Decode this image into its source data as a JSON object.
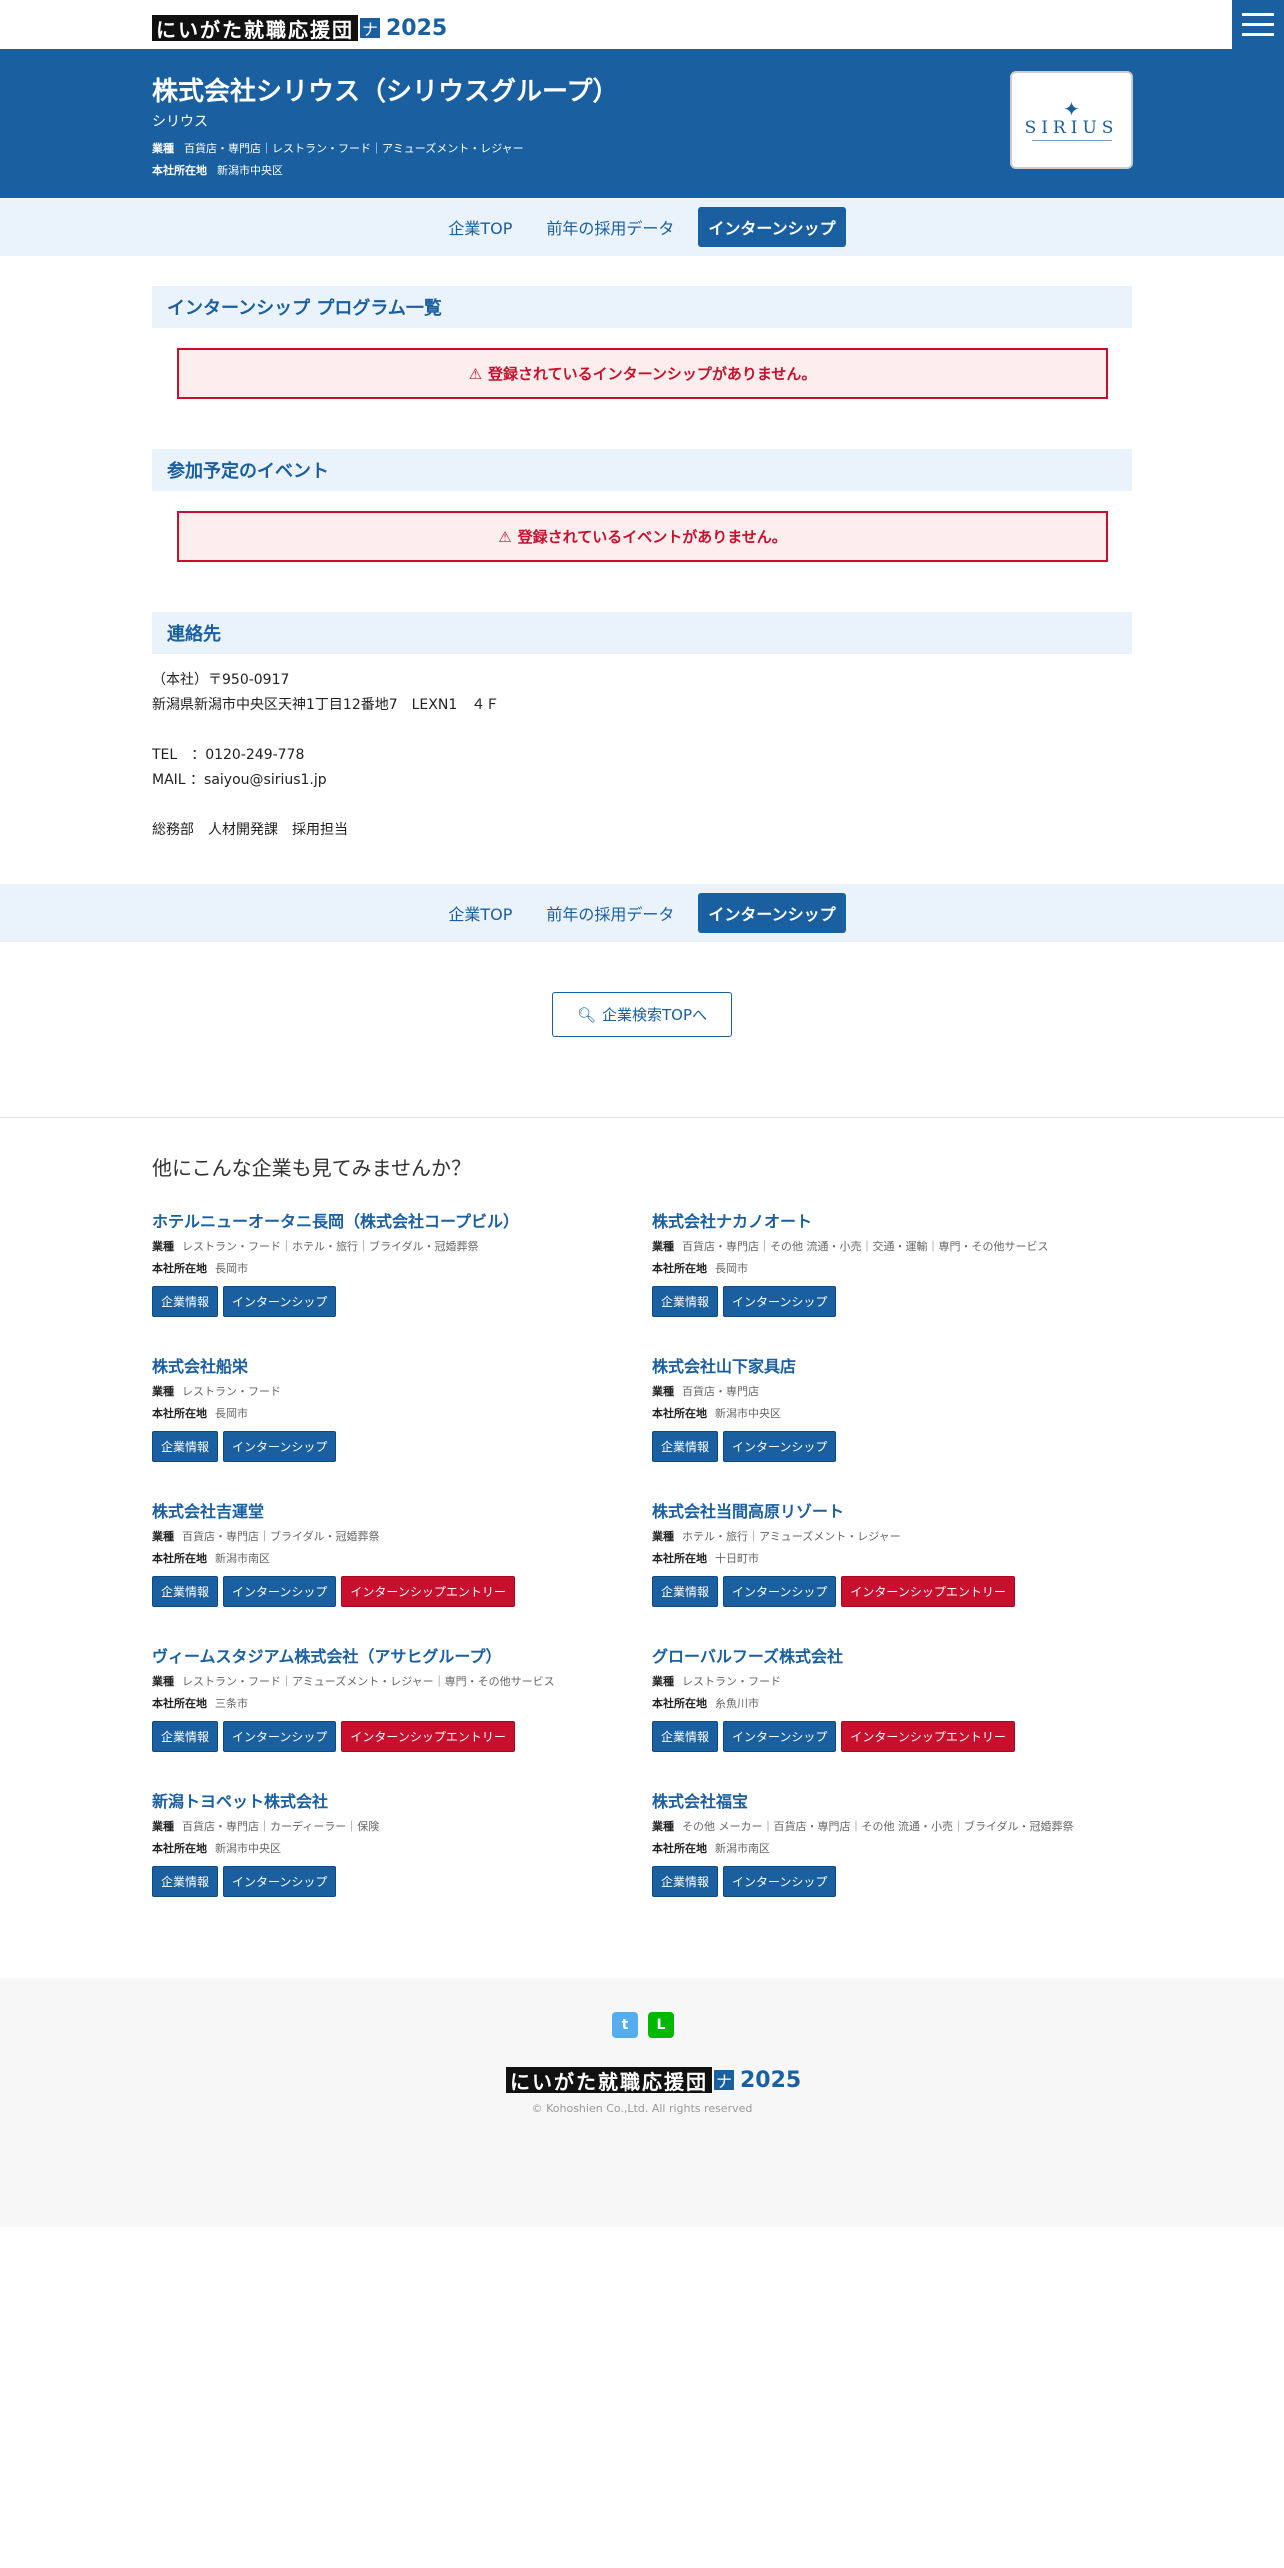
{
  "brand": {
    "logo_text": "にいがた就職応援団",
    "logo_mark": "ナビ",
    "year": "2025"
  },
  "company": {
    "name": "株式会社シリウス（シリウスグループ）",
    "kana": "シリウス",
    "industry_label": "業種",
    "industry": "百貨店・専門店｜レストラン・フード｜アミューズメント・レジャー",
    "location_label": "本社所在地",
    "location": "新潟市中央区",
    "logo_word": "SIRIUS"
  },
  "tabs": [
    {
      "label": "企業TOP"
    },
    {
      "label": "前年の採用データ"
    },
    {
      "label": "インターンシップ"
    }
  ],
  "sections": {
    "internship": {
      "title": "インターンシップ プログラム一覧",
      "alert": "登録されているインターンシップがありません。"
    },
    "events": {
      "title": "参加予定のイベント",
      "alert": "登録されているイベントがありません。"
    },
    "contact": {
      "title": "連絡先",
      "line1": "（本社）〒950-0917",
      "line2": "新潟県新潟市中央区天神1丁目12番地7　LEXN1　４Ｆ",
      "line3": "TEL　：0120-249-778",
      "line4": "MAIL ：saiyou@sirius1.jp",
      "line5": "総務部　人材開発課　採用担当"
    }
  },
  "search_button": "企業検索TOPへ",
  "others": {
    "title": "他にこんな企業も見てみませんか？",
    "industry_label": "業種",
    "location_label": "本社所在地",
    "info_label": "企業情報",
    "intern_label": "インターンシップ",
    "entry_label": "インターンシップエントリー",
    "companies": [
      {
        "name": "ホテルニューオータニ長岡（株式会社コープビル）",
        "industry": "レストラン・フード｜ホテル・旅行｜ブライダル・冠婚葬祭",
        "location": "長岡市",
        "entry": false
      },
      {
        "name": "株式会社ナカノオート",
        "industry": "百貨店・専門店｜その他 流通・小売｜交通・運輸｜専門・その他サービス",
        "location": "長岡市",
        "entry": false
      },
      {
        "name": "株式会社船栄",
        "industry": "レストラン・フード",
        "location": "長岡市",
        "entry": false
      },
      {
        "name": "株式会社山下家具店",
        "industry": "百貨店・専門店",
        "location": "新潟市中央区",
        "entry": false
      },
      {
        "name": "株式会社吉運堂",
        "industry": "百貨店・専門店｜ブライダル・冠婚葬祭",
        "location": "新潟市南区",
        "entry": true
      },
      {
        "name": "株式会社当間高原リゾート",
        "industry": "ホテル・旅行｜アミューズメント・レジャー",
        "location": "十日町市",
        "entry": true
      },
      {
        "name": "ヴィームスタジアム株式会社（アサヒグループ）",
        "industry": "レストラン・フード｜アミューズメント・レジャー｜専門・その他サービス",
        "location": "三条市",
        "entry": true
      },
      {
        "name": "グローバルフーズ株式会社",
        "industry": "レストラン・フード",
        "location": "糸魚川市",
        "entry": true
      },
      {
        "name": "新潟トヨペット株式会社",
        "industry": "百貨店・専門店｜カーディーラー｜保険",
        "location": "新潟市中央区",
        "entry": false
      },
      {
        "name": "株式会社福宝",
        "industry": "その他 メーカー｜百貨店・専門店｜その他 流通・小売｜ブライダル・冠婚葬祭",
        "location": "新潟市南区",
        "entry": false
      }
    ]
  },
  "footer": {
    "copyright": "© Kohoshien Co.,Ltd. All rights reserved",
    "twitter_icon": "twitter-icon",
    "line_icon": "line-icon"
  },
  "colors": {
    "primary": "#1a5fa0",
    "alert": "#c8102e",
    "light_bg": "#eaf3fc"
  }
}
